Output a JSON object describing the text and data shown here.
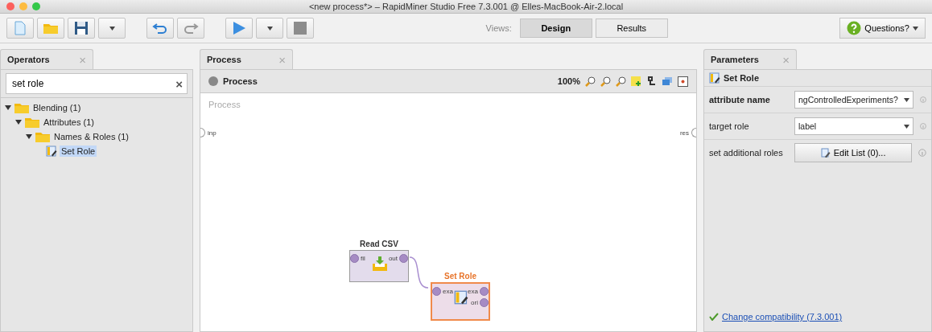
{
  "window": {
    "title": "<new process*> – RapidMiner Studio Free 7.3.001 @ Elles-MacBook-Air-2.local"
  },
  "toolbar": {
    "views_label": "Views:",
    "views": [
      {
        "label": "Design",
        "selected": true
      },
      {
        "label": "Results",
        "selected": false
      }
    ],
    "help": "Questions?"
  },
  "operators": {
    "tab": "Operators",
    "close": "×",
    "search": {
      "value": "set role",
      "clear": "×"
    },
    "tree": [
      {
        "label": "Blending (1)",
        "expanded": true,
        "selected": false,
        "children": [
          {
            "label": "Attributes (1)",
            "expanded": true,
            "selected": false,
            "children": [
              {
                "label": "Names & Roles (1)",
                "expanded": true,
                "selected": false,
                "children": [
                  {
                    "label": "Set Role",
                    "kind": "operator",
                    "selected": true
                  }
                ]
              }
            ]
          }
        ]
      }
    ]
  },
  "process": {
    "tab": "Process",
    "close": "×",
    "breadcrumb": "Process",
    "zoom": "100%",
    "canvas_title": "Process",
    "input_port": "inp",
    "result_port": "res",
    "nodes": [
      {
        "name": "Read CSV",
        "kind": "read",
        "selected": false,
        "in_ports": [
          "fil"
        ],
        "out_ports": [
          "out"
        ]
      },
      {
        "name": "Set Role",
        "kind": "role",
        "selected": true,
        "in_ports": [
          "exa"
        ],
        "out_ports": [
          "exa",
          "ori"
        ]
      }
    ]
  },
  "parameters": {
    "tab": "Parameters",
    "close": "×",
    "operator": "Set Role",
    "rows": [
      {
        "label": "attribute name",
        "kind": "dropdown",
        "value": "ngControlledExperiments?",
        "selected": true
      },
      {
        "label": "target role",
        "kind": "dropdown",
        "value": "label",
        "selected": false
      },
      {
        "label": "set additional roles",
        "kind": "button",
        "value": "Edit List (0)...",
        "selected": false
      }
    ],
    "compatibility": "Change compatibility (7.3.001)"
  }
}
